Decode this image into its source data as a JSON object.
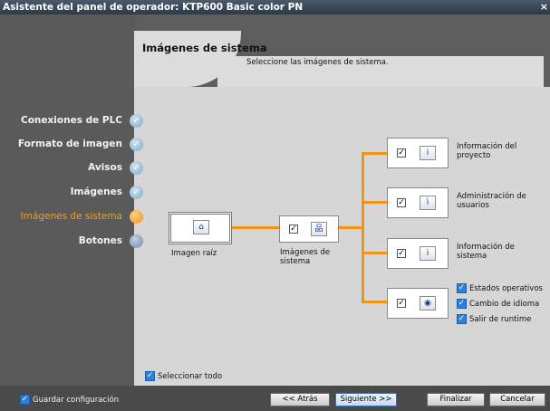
{
  "window": {
    "title": "Asistente del panel de operador: KTP600 Basic color PN",
    "close": "×"
  },
  "header": {
    "title": "Imágenes de sistema",
    "subtitle": "Seleccione las imágenes de sistema."
  },
  "nav": [
    {
      "label": "Conexiones de PLC",
      "state": "done"
    },
    {
      "label": "Formato de imagen",
      "state": "done"
    },
    {
      "label": "Avisos",
      "state": "done"
    },
    {
      "label": "Imágenes",
      "state": "done"
    },
    {
      "label": "Imágenes de sistema",
      "state": "current"
    },
    {
      "label": "Botones",
      "state": "todo"
    }
  ],
  "diagram": {
    "root_label": "Imagen raíz",
    "system_label": "Imágenes de sistema",
    "project_info": "Información del proyecto",
    "user_admin": "Administración de usuarios",
    "system_info": "Información de sistema",
    "op_states": "Estados operativos",
    "lang_change": "Cambio de idioma",
    "exit_runtime": "Salir de runtime"
  },
  "select_all": "Seleccionar todo",
  "footer": {
    "save_config": "Guardar configuración",
    "back": "<< Atrás",
    "next": "Siguiente >>",
    "finish": "Finalizar",
    "cancel": "Cancelar"
  },
  "colors": {
    "accent": "#f29418",
    "check": "#2f7fd6"
  }
}
